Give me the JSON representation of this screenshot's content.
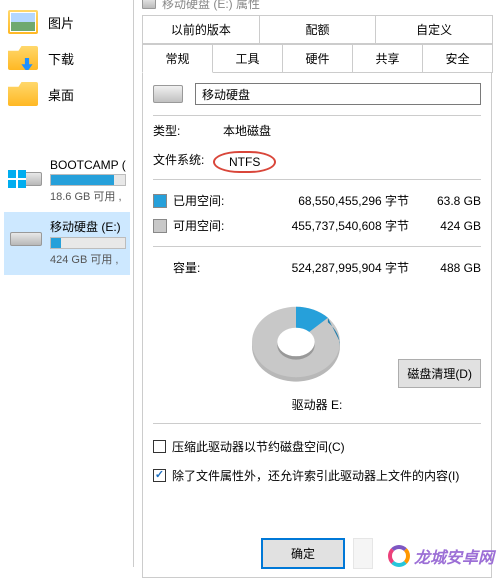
{
  "sidebar": {
    "nav": [
      {
        "label": "图片",
        "icon": "pictures"
      },
      {
        "label": "下载",
        "icon": "downloads"
      },
      {
        "label": "桌面",
        "icon": "desktop"
      }
    ],
    "drives": [
      {
        "name": "BOOTCAMP (",
        "sub": "18.6 GB 可用 ,",
        "icon": "win",
        "fill_pct": 85,
        "selected": false
      },
      {
        "name": "移动硬盘 (E:)",
        "sub": "424 GB 可用 ,",
        "icon": "hdd",
        "fill_pct": 13,
        "selected": true
      }
    ]
  },
  "dialog": {
    "title": "移动硬盘 (E:) 属性",
    "tabs_top": [
      "以前的版本",
      "配额",
      "自定义"
    ],
    "tabs_bottom": [
      "常规",
      "工具",
      "硬件",
      "共享",
      "安全"
    ],
    "active_tab": "常规",
    "drive_name": "移动硬盘",
    "type_label": "类型:",
    "type_value": "本地磁盘",
    "fs_label": "文件系统:",
    "fs_value": "NTFS",
    "used_label": "已用空间:",
    "used_bytes": "68,550,455,296 字节",
    "used_gb": "63.8 GB",
    "free_label": "可用空间:",
    "free_bytes": "455,737,540,608 字节",
    "free_gb": "424 GB",
    "cap_label": "容量:",
    "cap_bytes": "524,287,995,904 字节",
    "cap_gb": "488 GB",
    "drv_label": "驱动器 E:",
    "cleanup_btn": "磁盘清理(D)",
    "compress_label": "压缩此驱动器以节约磁盘空间(C)",
    "index_label": "除了文件属性外，还允许索引此驱动器上文件的内容(I)",
    "ok": "确定",
    "donut_used_deg": 47
  },
  "watermark": "龙城安卓网"
}
